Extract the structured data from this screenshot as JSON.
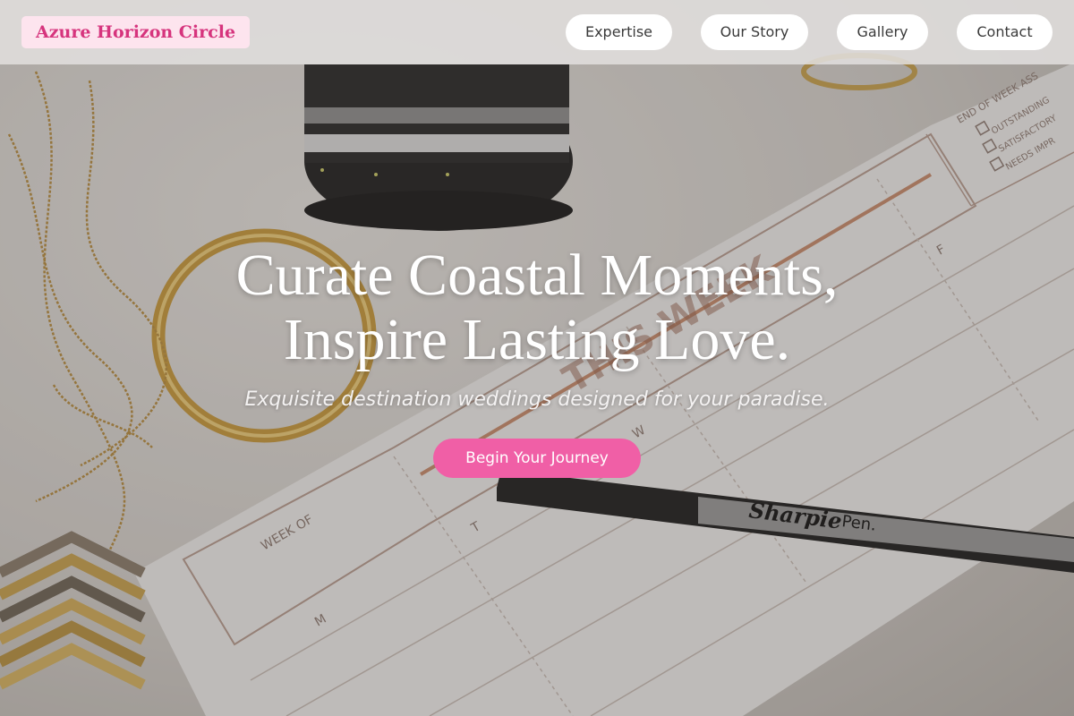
{
  "brand": {
    "name": "Azure Horizon Circle"
  },
  "nav": {
    "items": [
      {
        "label": "Expertise"
      },
      {
        "label": "Our Story"
      },
      {
        "label": "Gallery"
      },
      {
        "label": "Contact"
      }
    ]
  },
  "hero": {
    "headline_line1": "Curate Coastal Moments,",
    "headline_line2": "Inspire Lasting Love.",
    "tagline": "Exquisite destination weddings designed for your paradise.",
    "cta_label": "Begin Your Journey",
    "photo_elements": {
      "planner_title": "THIS WEEK",
      "planner_week_of": "WEEK OF",
      "planner_days": [
        "M",
        "T",
        "W",
        "F"
      ],
      "planner_assessment": "END OF WEEK ASS",
      "planner_checks": [
        "OUTSTANDING",
        "SATISFACTORY",
        "NEEDS IMPR"
      ],
      "pen_brand": "Sharpie",
      "pen_type": "Pen."
    }
  },
  "colors": {
    "brand_text": "#d6347d",
    "brand_bg": "#fde4ee",
    "cta_bg": "#f05fa6",
    "nav_button_bg": "#ffffff",
    "header_bg": "#e2e0de"
  }
}
